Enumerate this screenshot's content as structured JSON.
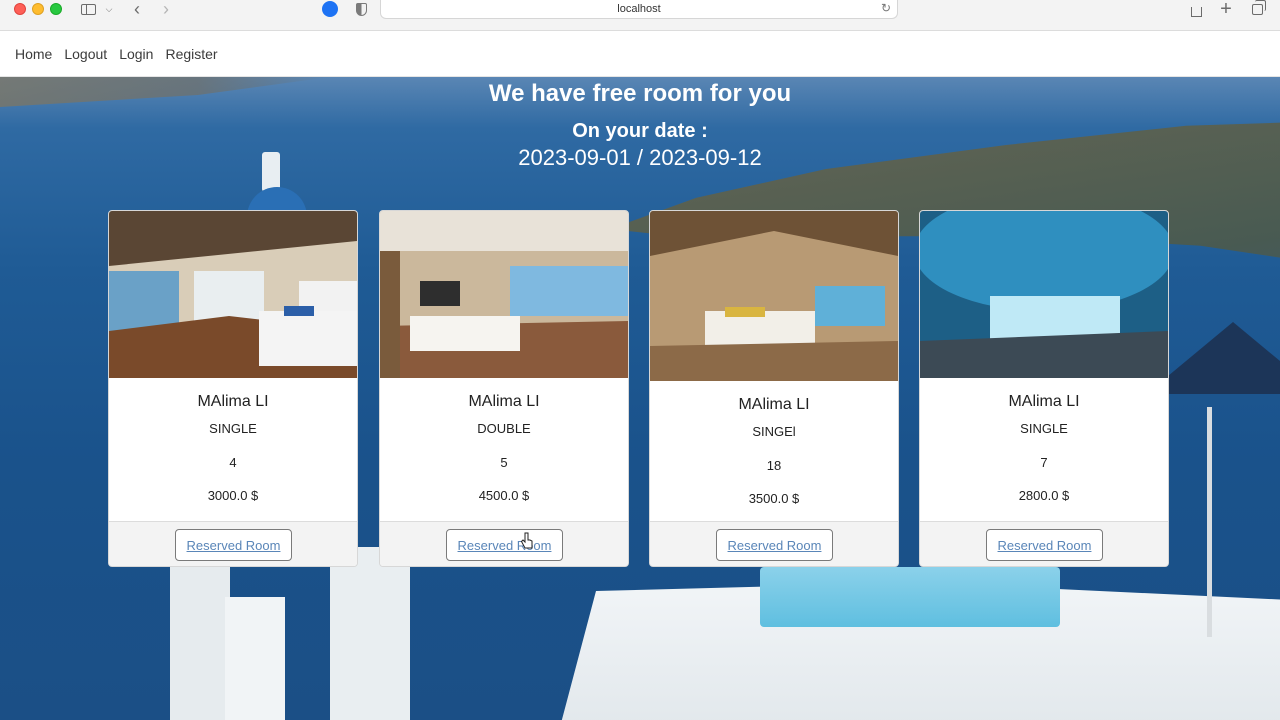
{
  "browser": {
    "url": "localhost",
    "icons": [
      "close-window-icon",
      "minimize-icon",
      "maximize-icon",
      "sidebar-icon",
      "chevron-down-icon",
      "back-icon",
      "forward-icon",
      "extension-icon",
      "privacy-shield-icon",
      "reload-icon",
      "share-icon",
      "new-tab-icon",
      "tab-overview-icon"
    ]
  },
  "nav": {
    "links": [
      "Home",
      "Logout",
      "Login",
      "Register"
    ]
  },
  "hero": {
    "title": "We have free room for you",
    "subtitle": "On your date :",
    "date_range": "2023-09-01 / 2023-09-12"
  },
  "rooms": [
    {
      "name": "MAlima LI",
      "type": "SINGLE",
      "number": "4",
      "price": "3000.0 $",
      "button": "Reserved Room"
    },
    {
      "name": "MAlima LI",
      "type": "DOUBLE",
      "number": "5",
      "price": "4500.0 $",
      "button": "Reserved Room"
    },
    {
      "name": "MAlima LI",
      "type": "SINGEl",
      "number": "18",
      "price": "3500.0 $",
      "button": "Reserved Room"
    },
    {
      "name": "MAlima LI",
      "type": "SINGLE",
      "number": "7",
      "price": "2800.0 $",
      "button": "Reserved Room"
    }
  ]
}
